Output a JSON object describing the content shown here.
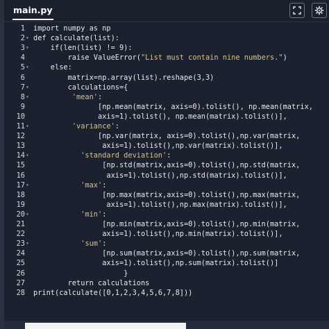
{
  "tab": {
    "label": "main.py"
  },
  "toolbar": {
    "expand_icon": "expand-icon",
    "settings_icon": "settings-icon"
  },
  "editor": {
    "lines": [
      {
        "num": "1",
        "fold": "",
        "indent": 0,
        "text": "import numpy as np"
      },
      {
        "num": "2",
        "fold": "▾",
        "indent": 0,
        "text": "def calculate(list):"
      },
      {
        "num": "3",
        "fold": "▾",
        "indent": 4,
        "text": "if(len(list) != 9):"
      },
      {
        "num": "4",
        "fold": "",
        "indent": 8,
        "text": "raise ValueError(\"List must contain nine numbers.\")"
      },
      {
        "num": "5",
        "fold": "▾",
        "indent": 4,
        "text": "else:"
      },
      {
        "num": "6",
        "fold": "",
        "indent": 8,
        "text": "matrix=np.array(list).reshape(3,3)"
      },
      {
        "num": "7",
        "fold": "▾",
        "indent": 8,
        "text": "calculations={"
      },
      {
        "num": "8",
        "fold": "▾",
        "indent": 9,
        "text": "'mean':"
      },
      {
        "num": "9",
        "fold": "",
        "indent": 15,
        "text": "[np.mean(matrix, axis=0).tolist(), np.mean(matrix,"
      },
      {
        "num": "10",
        "fold": "",
        "indent": 15,
        "text": "axis=1).tolist(), np.mean(matrix).tolist()],"
      },
      {
        "num": "11",
        "fold": "▾",
        "indent": 9,
        "text": "'variance':"
      },
      {
        "num": "12",
        "fold": "",
        "indent": 15,
        "text": "[np.var(matrix, axis=0).tolist(),np.var(matrix,"
      },
      {
        "num": "13",
        "fold": "",
        "indent": 16,
        "text": "axis=1).tolist(),np.var(matrix).tolist()],"
      },
      {
        "num": "14",
        "fold": "▾",
        "indent": 11,
        "text": "'standard deviation':"
      },
      {
        "num": "15",
        "fold": "",
        "indent": 16,
        "text": "[np.std(matrix,axis=0).tolist(),np.std(matrix,"
      },
      {
        "num": "16",
        "fold": "",
        "indent": 17,
        "text": "axis=1).tolist(),np.std(matrix).tolist()],"
      },
      {
        "num": "17",
        "fold": "▾",
        "indent": 11,
        "text": "'max':"
      },
      {
        "num": "18",
        "fold": "",
        "indent": 16,
        "text": "[np.max(matrix,axis=0).tolist(),np.max(matrix,"
      },
      {
        "num": "19",
        "fold": "",
        "indent": 17,
        "text": "axis=1).tolist(),np.max(matrix).tolist()],"
      },
      {
        "num": "20",
        "fold": "▾",
        "indent": 11,
        "text": "'min':"
      },
      {
        "num": "21",
        "fold": "",
        "indent": 16,
        "text": "[np.min(matrix,axis=0).tolist(),np.min(matrix,"
      },
      {
        "num": "22",
        "fold": "",
        "indent": 16,
        "text": "axis=1).tolist(),np.min(matrix).tolist()],"
      },
      {
        "num": "23",
        "fold": "▾",
        "indent": 11,
        "text": "'sum':"
      },
      {
        "num": "24",
        "fold": "",
        "indent": 16,
        "text": "[np.sum(matrix,axis=0).tolist(),np.sum(matrix,"
      },
      {
        "num": "25",
        "fold": "",
        "indent": 16,
        "text": "axis=1).tolist(),np.sum(matrix).tolist()]"
      },
      {
        "num": "26",
        "fold": "",
        "indent": 21,
        "text": "}"
      },
      {
        "num": "27",
        "fold": "",
        "indent": 8,
        "text": "return calculations"
      },
      {
        "num": "28",
        "fold": "",
        "indent": 0,
        "text": "print(calculate([0,1,2,3,4,5,6,7,8]))"
      }
    ]
  },
  "colors": {
    "background": "#1c2130",
    "header_bg": "#1b202d",
    "code_text": "#e8eaef",
    "string_text": "#d9c08a",
    "line_number": "#d8dbe3"
  }
}
